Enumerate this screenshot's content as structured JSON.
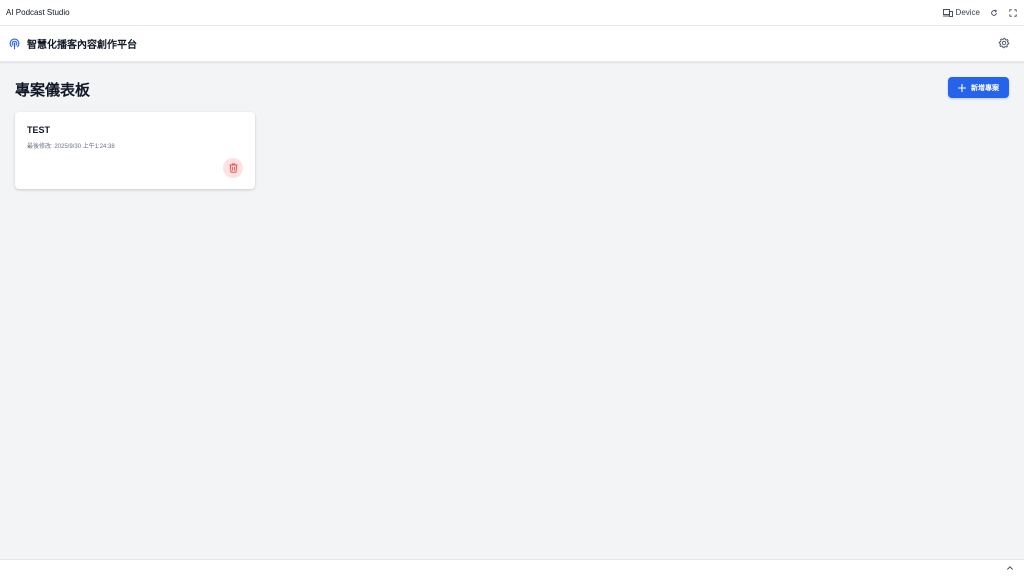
{
  "window": {
    "title": "AI Podcast Studio",
    "device_label": "Device",
    "icons": [
      "device-icon",
      "refresh-icon",
      "fullscreen-icon"
    ]
  },
  "header": {
    "brand_name": "智慧化播客內容創作平台",
    "brand_icon": "podcast-broadcast-icon",
    "settings_icon": "gear-icon",
    "brand_color": "#2563eb"
  },
  "dashboard": {
    "title": "專案儀表板",
    "new_project_label": "新增專案",
    "new_project_icon": "plus-icon",
    "projects": [
      {
        "name": "TEST",
        "last_modified": "最後修改: 2025/9/30 上午1:24:38",
        "delete_icon": "trash-icon"
      }
    ]
  },
  "colors": {
    "accent": "#2563eb",
    "danger": "#ef4444",
    "danger_bg": "#fee2e2",
    "background": "#f3f4f6"
  },
  "footer": {
    "toggle_icon": "chevron-up-icon"
  }
}
